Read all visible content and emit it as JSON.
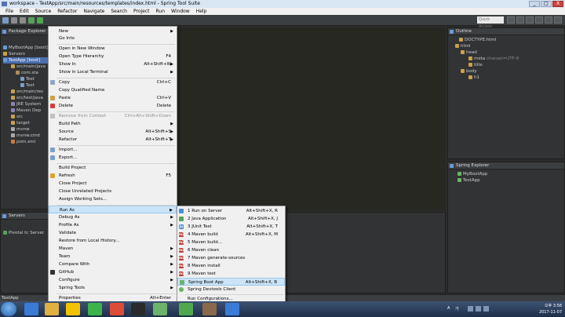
{
  "window": {
    "title": "workspace - TestApp/src/main/resources/templates/index.html - Spring Tool Suite",
    "controls": [
      "_",
      "□",
      "X"
    ]
  },
  "menubar": [
    "File",
    "Edit",
    "Source",
    "Refactor",
    "Navigate",
    "Search",
    "Project",
    "Run",
    "Window",
    "Help"
  ],
  "toolbar": {
    "quick_access": "Quick Access"
  },
  "package_explorer": {
    "title": "Package Explorer",
    "items": [
      {
        "label": "MyBootApp [boot]"
      },
      {
        "label": "Servers"
      },
      {
        "label": "TestApp [boot]"
      },
      {
        "label": "src/main/java"
      },
      {
        "label": "com.sta"
      },
      {
        "label": "Test"
      },
      {
        "label": "Test"
      },
      {
        "label": "src/main/res"
      },
      {
        "label": "src/test/java"
      },
      {
        "label": "JRE System"
      },
      {
        "label": "Maven Dep"
      },
      {
        "label": "src"
      },
      {
        "label": "target"
      },
      {
        "label": "mvnw"
      },
      {
        "label": "mvnw.cmd"
      },
      {
        "label": "pom.xml"
      }
    ]
  },
  "servers_panel": {
    "title": "Servers",
    "item": "Pivotal tc Server"
  },
  "outline": {
    "title": "Outline",
    "items": [
      {
        "label": "DOCTYPE:html"
      },
      {
        "label": "html"
      },
      {
        "label": "head"
      },
      {
        "label": "meta",
        "extra": "charset=UTF-8"
      },
      {
        "label": "title"
      },
      {
        "label": "body"
      },
      {
        "label": "h1"
      }
    ]
  },
  "spring_explorer": {
    "title": "Spring Explorer",
    "items": [
      {
        "label": "MyBootApp"
      },
      {
        "label": "TestApp"
      }
    ]
  },
  "context_menu": {
    "items": [
      {
        "label": "New",
        "arrow": true
      },
      {
        "label": "Go Into"
      },
      {
        "label": "Open in New Window"
      },
      {
        "label": "Open Type Hierarchy",
        "shortcut": "F4"
      },
      {
        "label": "Show In",
        "shortcut": "Alt+Shift+W",
        "arrow": true
      },
      {
        "label": "Show in Local Terminal",
        "arrow": true
      },
      {
        "label": "Copy",
        "shortcut": "Ctrl+C"
      },
      {
        "label": "Copy Qualified Name"
      },
      {
        "label": "Paste",
        "shortcut": "Ctrl+V"
      },
      {
        "label": "Delete",
        "shortcut": "Delete"
      },
      {
        "label": "Remove from Context",
        "shortcut": "Ctrl+Alt+Shift+Down",
        "disabled": true
      },
      {
        "label": "Build Path",
        "arrow": true
      },
      {
        "label": "Source",
        "shortcut": "Alt+Shift+S",
        "arrow": true
      },
      {
        "label": "Refactor",
        "shortcut": "Alt+Shift+T",
        "arrow": true
      },
      {
        "label": "Import..."
      },
      {
        "label": "Export..."
      },
      {
        "label": "Build Project"
      },
      {
        "label": "Refresh",
        "shortcut": "F5"
      },
      {
        "label": "Close Project"
      },
      {
        "label": "Close Unrelated Projects"
      },
      {
        "label": "Assign Working Sets..."
      },
      {
        "label": "Run As",
        "arrow": true
      },
      {
        "label": "Debug As",
        "arrow": true
      },
      {
        "label": "Profile As",
        "arrow": true
      },
      {
        "label": "Validate"
      },
      {
        "label": "Restore from Local History..."
      },
      {
        "label": "Maven",
        "arrow": true
      },
      {
        "label": "Team",
        "arrow": true
      },
      {
        "label": "Compare With",
        "arrow": true
      },
      {
        "label": "GitHub",
        "arrow": true
      },
      {
        "label": "Configure",
        "arrow": true
      },
      {
        "label": "Spring Tools",
        "arrow": true
      },
      {
        "label": "Properties",
        "shortcut": "Alt+Enter"
      }
    ]
  },
  "run_as_submenu": {
    "items": [
      {
        "label": "1 Run on Server",
        "shortcut": "Alt+Shift+X, R"
      },
      {
        "label": "2 Java Application",
        "shortcut": "Alt+Shift+X, J"
      },
      {
        "label": "3 JUnit Test",
        "shortcut": "Alt+Shift+X, T"
      },
      {
        "label": "4 Maven build",
        "shortcut": "Alt+Shift+X, M"
      },
      {
        "label": "5 Maven build..."
      },
      {
        "label": "6 Maven clean"
      },
      {
        "label": "7 Maven generate-sources"
      },
      {
        "label": "8 Maven install"
      },
      {
        "label": "9 Maven test"
      },
      {
        "label": "Spring Boot App",
        "shortcut": "Alt+Shift+X, B"
      },
      {
        "label": "Spring Devtools Client"
      },
      {
        "label": "Run Configurations..."
      }
    ],
    "ico_m2": "m2",
    "ico_ju": "Ju"
  },
  "status_bar": {
    "text": "TestApp"
  },
  "taskbar": {
    "time": "오후 3:58",
    "date": "2017-11-07",
    "tray": [
      "A",
      "가"
    ]
  },
  "colors": {
    "highlight": "#cce4f7",
    "menu_bg": "#f0f0f0",
    "editor_bg": "#272822",
    "panel_bg": "#313335"
  }
}
